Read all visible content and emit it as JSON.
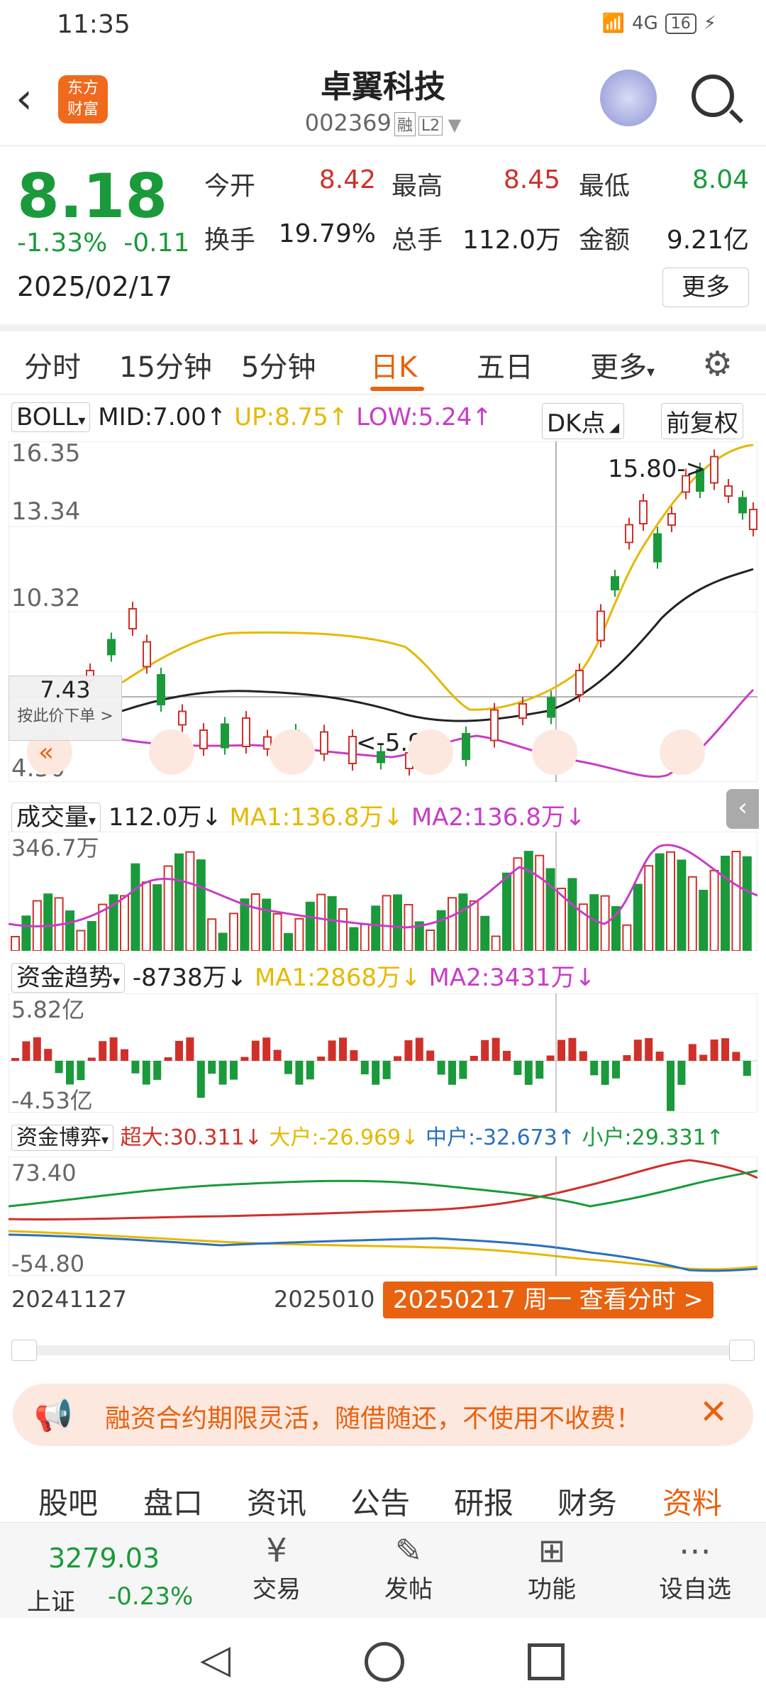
{
  "status_bar": {
    "time": "11:35",
    "network": "4G",
    "battery": "16"
  },
  "header": {
    "title": "卓翼科技",
    "code": "002369",
    "tag1": "融",
    "tag2": "L2",
    "logo_line1": "东方",
    "logo_line2": "财富"
  },
  "quote": {
    "price": "8.18",
    "change_pct": "-1.33%",
    "change": "-0.11",
    "date": "2025/02/17",
    "open_label": "今开",
    "open": "8.42",
    "high_label": "最高",
    "high": "8.45",
    "low_label": "最低",
    "low": "8.04",
    "turnover_label": "换手",
    "turnover": "19.79%",
    "volume_label": "总手",
    "volume": "112.0万",
    "amount_label": "金额",
    "amount": "9.21亿",
    "more": "更多"
  },
  "tabs": [
    {
      "label": "分时"
    },
    {
      "label": "15分钟"
    },
    {
      "label": "5分钟"
    },
    {
      "label": "日K"
    },
    {
      "label": "五日"
    },
    {
      "label": "更多"
    }
  ],
  "boll": {
    "selector": "BOLL",
    "mid": "MID:7.00↑",
    "up": "UP:8.75↑",
    "low": "LOW:5.24↑",
    "dk": "DK点",
    "fq": "前复权",
    "y_top": "16.35",
    "y_2": "13.34",
    "y_3": "10.32",
    "y_bottom": "4.30",
    "crosshair_price": "7.43",
    "order_hint": "按此价下单 >",
    "annot_high": "15.80->",
    "annot_low": "<-5.92"
  },
  "volume": {
    "selector": "成交量",
    "value": "112.0万↓",
    "ma1": "MA1:136.8万↓",
    "ma2": "MA2:136.8万↓",
    "y_top": "346.7万"
  },
  "fund_trend": {
    "selector": "资金趋势",
    "value": "-8738万↓",
    "ma1": "MA1:2868万↓",
    "ma2": "MA2:3431万↓",
    "y_top": "5.82亿",
    "y_bottom": "-4.53亿"
  },
  "fund_game": {
    "selector": "资金博弈",
    "super": "超大:30.311↓",
    "big": "大户:-26.969↓",
    "mid": "中户:-32.673↑",
    "small": "小户:29.331↑",
    "y_top": "73.40",
    "y_bottom": "-54.80"
  },
  "x_axis": {
    "start": "20241127",
    "mid": "2025010",
    "tooltip": "20250217 周一 查看分时 >"
  },
  "banner": {
    "text": "融资合约期限灵活，随借随还，不使用不收费！"
  },
  "bottom_tabs": [
    {
      "label": "股吧"
    },
    {
      "label": "盘口"
    },
    {
      "label": "资讯"
    },
    {
      "label": "公告"
    },
    {
      "label": "研报"
    },
    {
      "label": "财务"
    },
    {
      "label": "资料"
    }
  ],
  "nav": {
    "index_value": "3279.03",
    "index_name": "上证",
    "index_change": "-0.23%",
    "items": [
      {
        "label": "交易"
      },
      {
        "label": "发帖"
      },
      {
        "label": "功能"
      },
      {
        "label": "设自选"
      }
    ]
  },
  "colors": {
    "up": "#d0302a",
    "down": "#1a9a3a",
    "accent": "#e8620f",
    "ma1": "#e6b800",
    "ma2": "#c83cc8"
  }
}
